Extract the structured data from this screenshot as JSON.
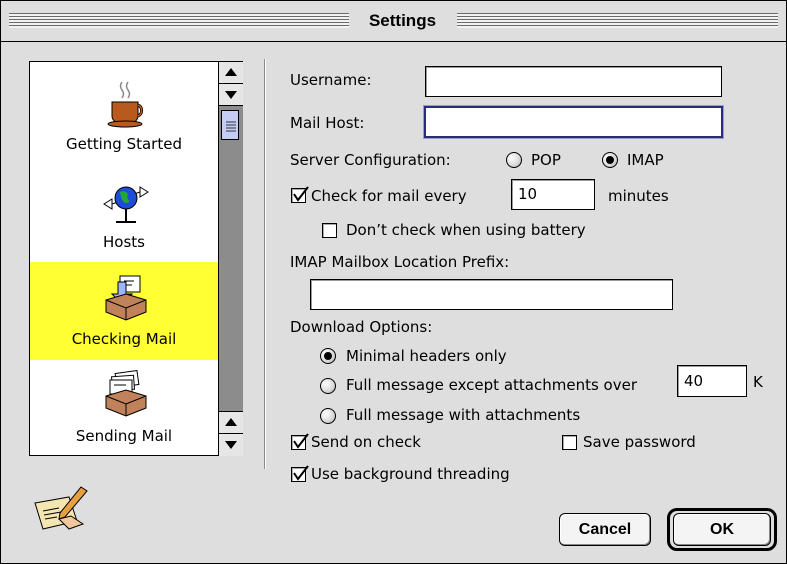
{
  "window": {
    "title": "Settings"
  },
  "sidebar": {
    "items": [
      {
        "label": "Getting Started",
        "icon": "coffee-cup-icon",
        "selected": false
      },
      {
        "label": "Hosts",
        "icon": "globe-network-icon",
        "selected": false
      },
      {
        "label": "Checking Mail",
        "icon": "mailbox-tray-in-icon",
        "selected": true
      },
      {
        "label": "Sending Mail",
        "icon": "mail-tray-out-icon",
        "selected": false
      }
    ]
  },
  "form": {
    "username": {
      "label": "Username:",
      "value": ""
    },
    "mail_host": {
      "label": "Mail Host:",
      "value": ""
    },
    "server_config": {
      "label": "Server Configuration:",
      "options": [
        "POP",
        "IMAP"
      ],
      "selected": "IMAP"
    },
    "check_mail": {
      "label": "Check for mail every",
      "value": "10",
      "unit": "minutes",
      "checked": true
    },
    "battery": {
      "label": "Don’t check when using battery",
      "checked": false
    },
    "imap_prefix": {
      "label": "IMAP Mailbox Location Prefix:",
      "value": ""
    },
    "download": {
      "label": "Download Options:",
      "options": [
        "Minimal headers only",
        "Full message except attachments over",
        "Full message with attachments"
      ],
      "selected": 0,
      "size_value": "40",
      "size_unit": "K"
    },
    "send_on_check": {
      "label": "Send on check",
      "checked": true
    },
    "save_password": {
      "label": "Save password",
      "checked": false
    },
    "background_threading": {
      "label": "Use background threading",
      "checked": true
    }
  },
  "buttons": {
    "cancel": "Cancel",
    "ok": "OK"
  },
  "colors": {
    "selection": "#ffff33",
    "window_bg": "#dedede",
    "focus_ring": "#2b2b7a"
  }
}
